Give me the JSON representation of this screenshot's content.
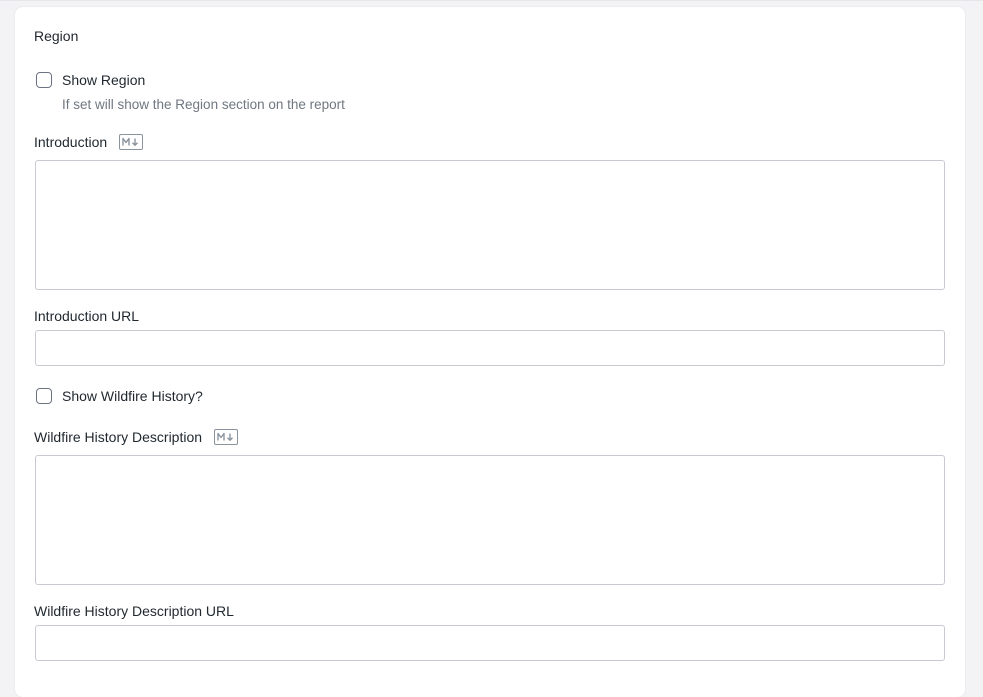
{
  "section": {
    "title": "Region"
  },
  "fields": {
    "show_region": {
      "label": "Show Region",
      "help": "If set will show the Region section on the report",
      "checked": false
    },
    "introduction": {
      "label": "Introduction",
      "value": "",
      "markdown_icon": "markdown-icon"
    },
    "introduction_url": {
      "label": "Introduction URL",
      "value": ""
    },
    "show_wildfire_history": {
      "label": "Show Wildfire History?",
      "checked": false
    },
    "wildfire_history_description": {
      "label": "Wildfire History Description",
      "value": "",
      "markdown_icon": "markdown-icon"
    },
    "wildfire_history_description_url": {
      "label": "Wildfire History Description URL",
      "value": ""
    }
  },
  "colors": {
    "background": "#f3f3f5",
    "card": "#ffffff",
    "border": "#c7cbd1",
    "help_text": "#6f7780"
  }
}
